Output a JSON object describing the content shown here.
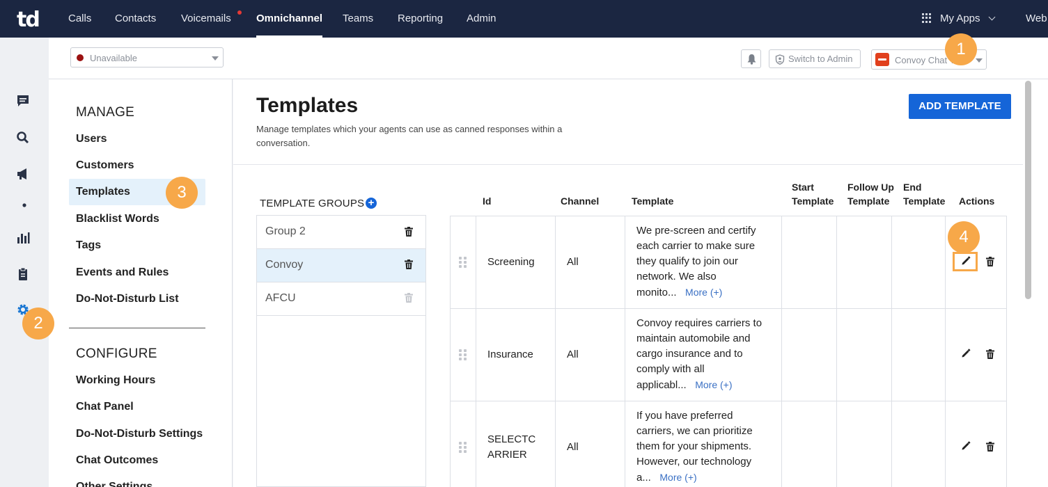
{
  "app": {
    "logo": "td"
  },
  "topnav": {
    "items": [
      "Calls",
      "Contacts",
      "Voicemails",
      "Omnichannel",
      "Teams",
      "Reporting",
      "Admin"
    ],
    "active": "Omnichannel",
    "my_apps": "My Apps",
    "web": "Web"
  },
  "subheader": {
    "status": "Unavailable",
    "status_color": "#9b1111",
    "switch_admin": "Switch to Admin",
    "account": "Convoy Chat T"
  },
  "sidebar": {
    "manage_heading": "MANAGE",
    "manage_items": [
      "Users",
      "Customers",
      "Templates",
      "Blacklist Words",
      "Tags",
      "Events and Rules",
      "Do-Not-Disturb List"
    ],
    "active": "Templates",
    "configure_heading": "CONFIGURE",
    "configure_items": [
      "Working Hours",
      "Chat Panel",
      "Do-Not-Disturb Settings",
      "Chat Outcomes",
      "Other Settings"
    ]
  },
  "main": {
    "title": "Templates",
    "description": "Manage templates which your agents can use as canned responses within a conversation.",
    "add_button": "ADD TEMPLATE",
    "groups_title": "TEMPLATE GROUPS",
    "groups": [
      {
        "name": "Group 2",
        "selected": false
      },
      {
        "name": "Convoy",
        "selected": true
      },
      {
        "name": "AFCU",
        "selected": false
      }
    ],
    "columns": {
      "id": "Id",
      "channel": "Channel",
      "template": "Template",
      "start_1": "Start",
      "start_2": "Template",
      "follow_1": "Follow Up",
      "follow_2": "Template",
      "end_1": "End",
      "end_2": "Template",
      "actions": "Actions"
    },
    "rows": [
      {
        "id_1": "Screening",
        "id_2": "",
        "channel": "All",
        "lines": [
          "We pre-screen and certify",
          "each carrier to make sure",
          "they qualify to join our",
          "network. We also"
        ],
        "last": "monito...",
        "more": "More (+)"
      },
      {
        "id_1": "Insurance",
        "id_2": "",
        "channel": "All",
        "lines": [
          "Convoy requires carriers to",
          "maintain automobile and",
          "cargo insurance and to",
          "comply with all"
        ],
        "last": "applicabl...",
        "more": "More (+)"
      },
      {
        "id_1": "SELECTC",
        "id_2": "ARRIER",
        "channel": "All",
        "lines": [
          "If you have preferred",
          "carriers, we can prioritize",
          "them for your shipments.",
          "However, our technology"
        ],
        "last": "a...",
        "more": "More (+)"
      }
    ]
  },
  "annotations": [
    "1",
    "2",
    "3",
    "4"
  ],
  "colors": {
    "nav_bg": "#1b2641",
    "primary": "#1565d8",
    "badge": "#f7a849",
    "selected_bg": "#e4f1fb"
  }
}
